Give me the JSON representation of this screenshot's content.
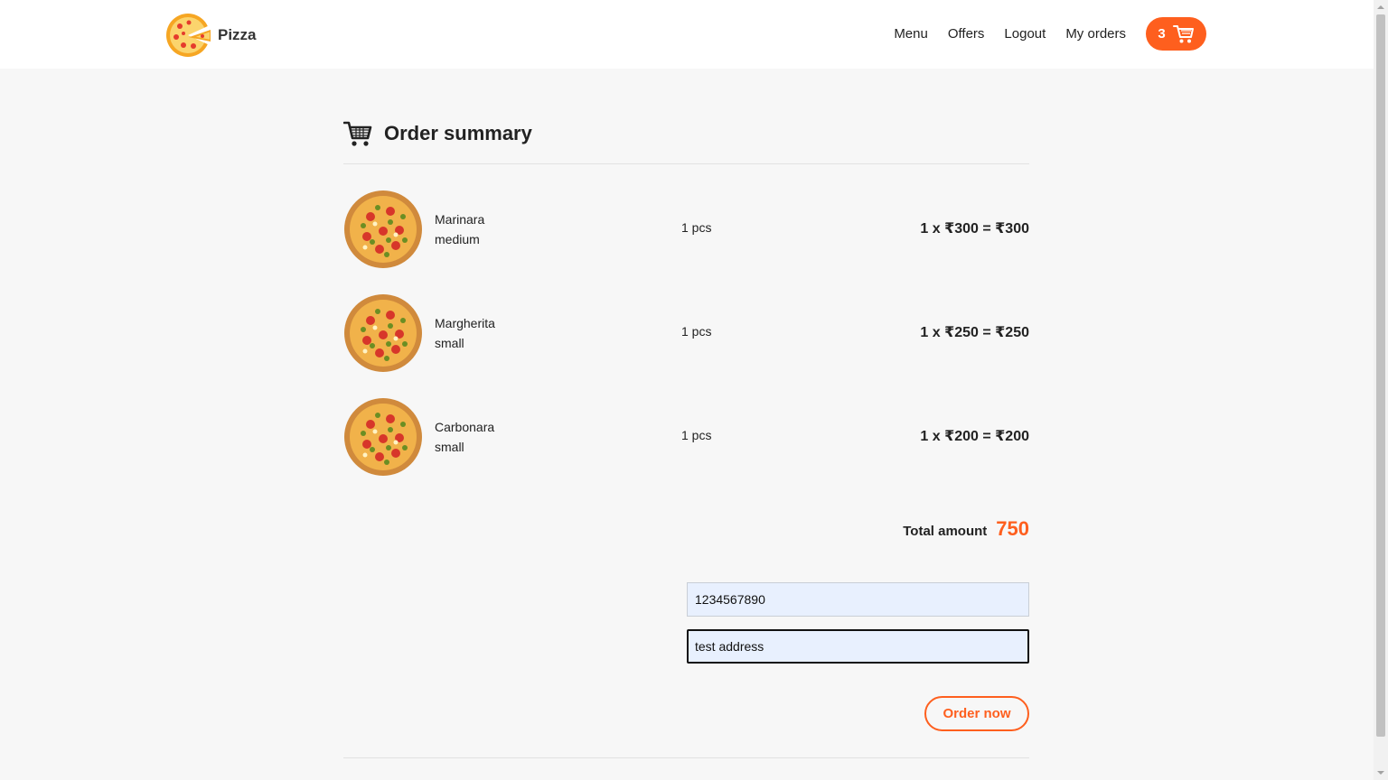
{
  "brand": {
    "name": "Pizza",
    "logo_icon": "pizza-logo-icon"
  },
  "nav": {
    "links": [
      "Menu",
      "Offers",
      "Logout",
      "My orders"
    ],
    "cart_count": "3",
    "cart_icon": "shopping-cart-icon"
  },
  "summary": {
    "title": "Order summary",
    "icon": "shopping-cart-icon",
    "items": [
      {
        "name": "Marinara",
        "size": "medium",
        "qty": "1 pcs",
        "price": "1 x ₹300 = ₹300"
      },
      {
        "name": "Margherita",
        "size": "small",
        "qty": "1 pcs",
        "price": "1 x ₹250 = ₹250"
      },
      {
        "name": "Carbonara",
        "size": "small",
        "qty": "1 pcs",
        "price": "1 x ₹200 = ₹200"
      }
    ],
    "total_label": "Total amount",
    "total_value": "750"
  },
  "form": {
    "phone_value": "1234567890",
    "address_value": "test address",
    "order_button": "Order now"
  },
  "colors": {
    "accent": "#fe5f1e",
    "background": "#f7f7f7",
    "input_bg": "#e8f0fe"
  }
}
